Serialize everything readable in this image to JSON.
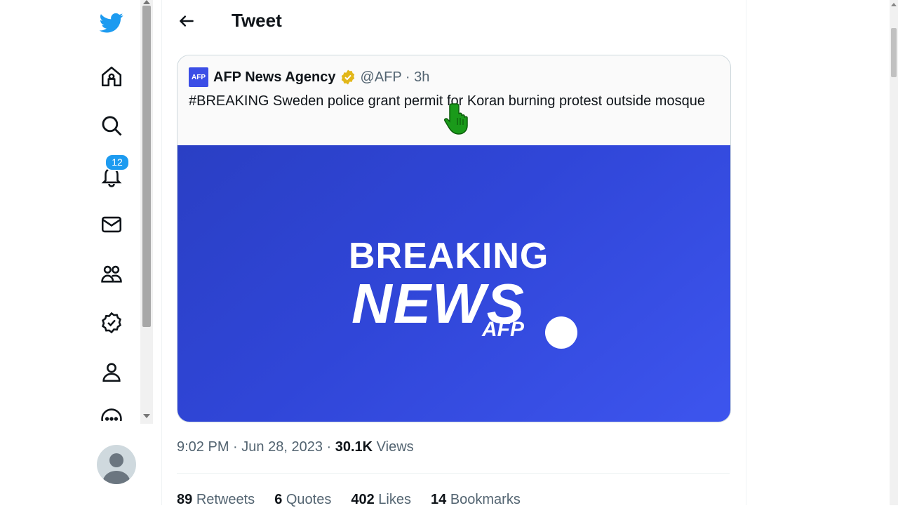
{
  "colors": {
    "brand": "#1d9bf0",
    "afp_blue": "#3b4ee6",
    "verified_gold": "#e2b719",
    "cursor_green": "#1a9a1a"
  },
  "nav": {
    "items": [
      {
        "icon": "twitter-bird-icon"
      },
      {
        "icon": "home-icon"
      },
      {
        "icon": "search-icon"
      },
      {
        "icon": "bell-icon",
        "badge": "12"
      },
      {
        "icon": "mail-icon"
      },
      {
        "icon": "communities-icon"
      },
      {
        "icon": "verified-icon"
      },
      {
        "icon": "profile-icon"
      },
      {
        "icon": "more-icon"
      }
    ]
  },
  "header": {
    "title": "Tweet"
  },
  "quoted": {
    "account_name": "AFP News Agency",
    "handle_time": "@AFP · 3h",
    "logo_text": "AFP",
    "text": "#BREAKING Sweden police grant permit for Koran burning protest outside mosque",
    "media": {
      "line1": "BREAKING",
      "line2": "NEWS",
      "mark": "AFP"
    }
  },
  "meta": {
    "time": "9:02 PM",
    "date": "Jun 28, 2023",
    "views_count": "30.1K",
    "views_label": "Views",
    "sep": "·"
  },
  "stats": [
    {
      "count": "89",
      "label": "Retweets"
    },
    {
      "count": "6",
      "label": "Quotes"
    },
    {
      "count": "402",
      "label": "Likes"
    },
    {
      "count": "14",
      "label": "Bookmarks"
    }
  ]
}
